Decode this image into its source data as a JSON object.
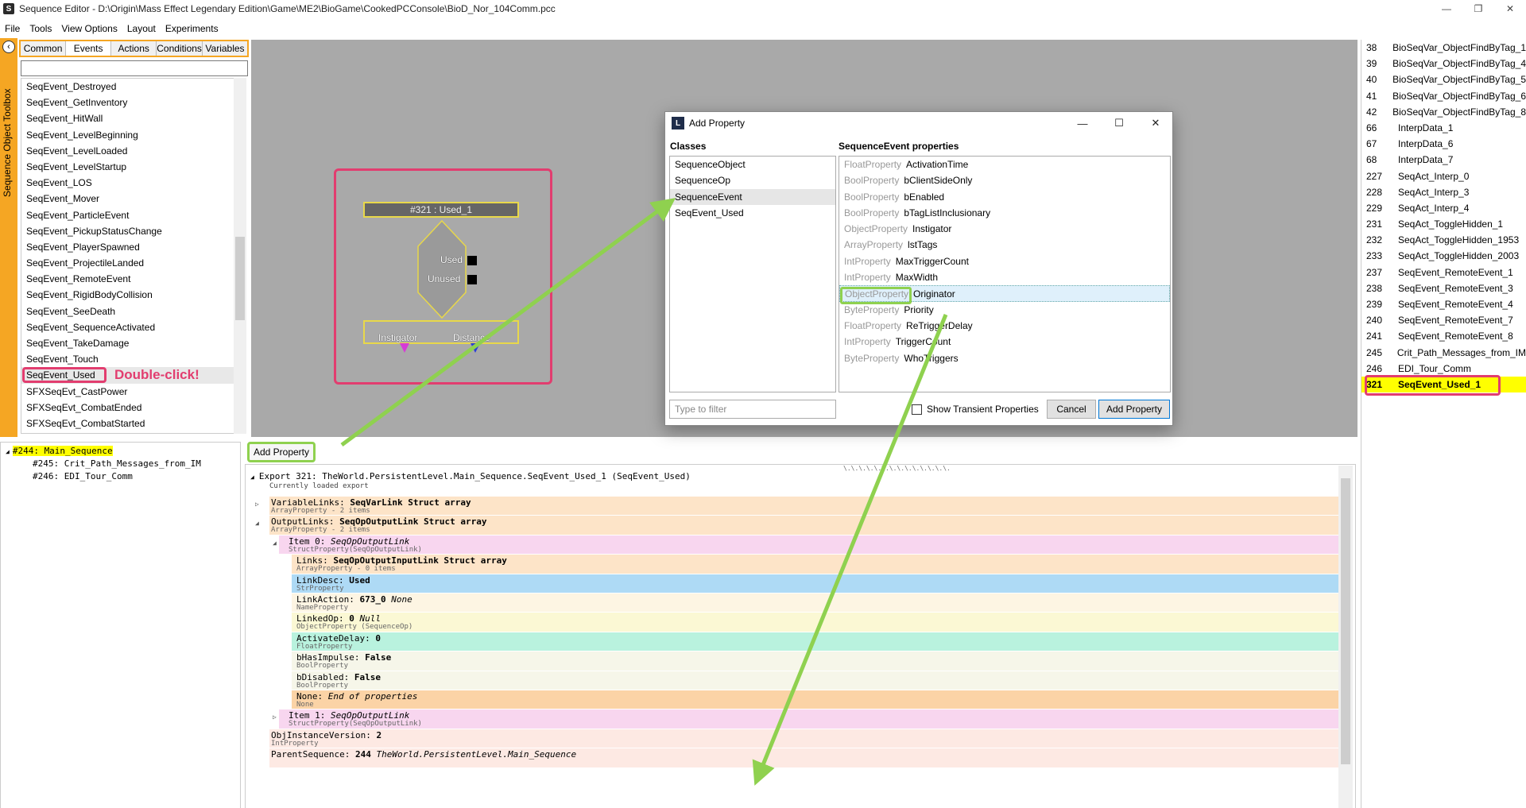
{
  "window": {
    "title": "Sequence Editor - D:\\Origin\\Mass Effect Legendary Edition\\Game\\ME2\\BioGame\\CookedPCConsole\\BioD_Nor_104Comm.pcc",
    "app_icon": "S",
    "minimize": "—",
    "maximize": "❐",
    "close": "✕"
  },
  "menu": [
    "File",
    "Tools",
    "View Options",
    "Layout",
    "Experiments"
  ],
  "toolbox": {
    "label": "Sequence Object Toolbox",
    "back_glyph": "‹",
    "tabs": [
      "Common",
      "Events",
      "Actions",
      "Conditions",
      "Variables"
    ],
    "active_tab": "Events",
    "events": [
      "SeqEvent_Destroyed",
      "SeqEvent_GetInventory",
      "SeqEvent_HitWall",
      "SeqEvent_LevelBeginning",
      "SeqEvent_LevelLoaded",
      "SeqEvent_LevelStartup",
      "SeqEvent_LOS",
      "SeqEvent_Mover",
      "SeqEvent_ParticleEvent",
      "SeqEvent_PickupStatusChange",
      "SeqEvent_PlayerSpawned",
      "SeqEvent_ProjectileLanded",
      "SeqEvent_RemoteEvent",
      "SeqEvent_RigidBodyCollision",
      "SeqEvent_SeeDeath",
      "SeqEvent_SequenceActivated",
      "SeqEvent_TakeDamage",
      "SeqEvent_Touch",
      "SeqEvent_Used",
      "SFXSeqEvt_CastPower",
      "SFXSeqEvt_CombatEnded",
      "SFXSeqEvt_CombatStarted"
    ],
    "selected_event_index": 18,
    "annotation": "Double-click!"
  },
  "node": {
    "title": "#321 : Used_1",
    "outputs": [
      "Used",
      "Unused"
    ],
    "vars": [
      "Instigator",
      "Distance"
    ]
  },
  "right_list": [
    {
      "id": "38",
      "name": "BioSeqVar_ObjectFindByTag_1"
    },
    {
      "id": "39",
      "name": "BioSeqVar_ObjectFindByTag_4"
    },
    {
      "id": "40",
      "name": "BioSeqVar_ObjectFindByTag_5"
    },
    {
      "id": "41",
      "name": "BioSeqVar_ObjectFindByTag_6"
    },
    {
      "id": "42",
      "name": "BioSeqVar_ObjectFindByTag_8"
    },
    {
      "id": "66",
      "name": "InterpData_1"
    },
    {
      "id": "67",
      "name": "InterpData_6"
    },
    {
      "id": "68",
      "name": "InterpData_7"
    },
    {
      "id": "227",
      "name": "SeqAct_Interp_0"
    },
    {
      "id": "228",
      "name": "SeqAct_Interp_3"
    },
    {
      "id": "229",
      "name": "SeqAct_Interp_4"
    },
    {
      "id": "231",
      "name": "SeqAct_ToggleHidden_1"
    },
    {
      "id": "232",
      "name": "SeqAct_ToggleHidden_1953"
    },
    {
      "id": "233",
      "name": "SeqAct_ToggleHidden_2003"
    },
    {
      "id": "237",
      "name": "SeqEvent_RemoteEvent_1"
    },
    {
      "id": "238",
      "name": "SeqEvent_RemoteEvent_3"
    },
    {
      "id": "239",
      "name": "SeqEvent_RemoteEvent_4"
    },
    {
      "id": "240",
      "name": "SeqEvent_RemoteEvent_7"
    },
    {
      "id": "241",
      "name": "SeqEvent_RemoteEvent_8"
    },
    {
      "id": "245",
      "name": "Crit_Path_Messages_from_IM"
    },
    {
      "id": "246",
      "name": "EDI_Tour_Comm"
    },
    {
      "id": "321",
      "name": "SeqEvent_Used_1"
    }
  ],
  "right_selected_index": 21,
  "tree": [
    {
      "label": "#244: Main_Sequence",
      "level": 0,
      "highlight": true
    },
    {
      "label": "#245: Crit_Path_Messages_from_IM",
      "level": 1,
      "highlight": false
    },
    {
      "label": "#246: EDI_Tour_Comm",
      "level": 1,
      "highlight": false
    }
  ],
  "tree_toggle": "◢",
  "add_property_button": "Add Property",
  "props_header": {
    "export": "Export 321: TheWorld.PersistentLevel.Main_Sequence.SeqEvent_Used_1 (SeqEvent_Used)",
    "sub": "Currently loaded export",
    "dots": "\\.\\.\\.\\.\\.\\.\\.\\.\\.\\.\\.\\.\\.\\."
  },
  "props": [
    {
      "indent": 0,
      "arrow": "▷",
      "name": "VariableLinks: ",
      "value": "SeqVarLink Struct array",
      "type": "ArrayProperty - 2 items",
      "bg": "#fde4c8",
      "italic": false
    },
    {
      "indent": 0,
      "arrow": "◢",
      "name": "OutputLinks: ",
      "value": "SeqOpOutputLink Struct array",
      "type": "ArrayProperty - 2 items",
      "bg": "#fde4c8",
      "italic": false
    },
    {
      "indent": 1,
      "arrow": "◢",
      "name": "Item 0: ",
      "value": "SeqOpOutputLink",
      "type": "StructProperty(SeqOpOutputLink)",
      "bg": "#f8d6ef",
      "italic": true
    },
    {
      "indent": 2,
      "arrow": "",
      "name": "Links: ",
      "value": "SeqOpOutputInputLink Struct array",
      "type": "ArrayProperty - 0 items",
      "bg": "#fde4c8",
      "italic": false
    },
    {
      "indent": 2,
      "arrow": "",
      "name": "LinkDesc: ",
      "value": "Used",
      "type": "StrProperty",
      "bg": "#aedaf5",
      "italic": false
    },
    {
      "indent": 2,
      "arrow": "",
      "name": "LinkAction: ",
      "value": "673_0 ",
      "extra": "None",
      "type": "NameProperty",
      "bg": "#fdf5e3",
      "italic": false
    },
    {
      "indent": 2,
      "arrow": "",
      "name": "LinkedOp: ",
      "value": "0 ",
      "extra": "Null",
      "type": "ObjectProperty (SequenceOp)",
      "bg": "#fbf8d4",
      "italic": false
    },
    {
      "indent": 2,
      "arrow": "",
      "name": "ActivateDelay: ",
      "value": "0",
      "type": "FloatProperty",
      "bg": "#b9f2de",
      "italic": false
    },
    {
      "indent": 2,
      "arrow": "",
      "name": "bHasImpulse: ",
      "value": "False",
      "type": "BoolProperty",
      "bg": "#f6f6e9",
      "italic": false
    },
    {
      "indent": 2,
      "arrow": "",
      "name": "bDisabled: ",
      "value": "False",
      "type": "BoolProperty",
      "bg": "#f6f6e9",
      "italic": false
    },
    {
      "indent": 2,
      "arrow": "",
      "name": "None: ",
      "value": "End of properties",
      "type": "None",
      "bg": "#fbd3a6",
      "italic": true
    },
    {
      "indent": 1,
      "arrow": "▷",
      "name": "Item 1: ",
      "value": "SeqOpOutputLink",
      "type": "StructProperty(SeqOpOutputLink)",
      "bg": "#f8d6ef",
      "italic": true
    },
    {
      "indent": 0,
      "arrow": "",
      "name": "ObjInstanceVersion: ",
      "value": "2",
      "type": "IntProperty",
      "bg": "#fde9e3",
      "italic": false
    },
    {
      "indent": 0,
      "arrow": "",
      "name": "ParentSequence: ",
      "value": "244 ",
      "extra": "TheWorld.PersistentLevel.Main_Sequence",
      "type": "",
      "bg": "#fde9e3",
      "italic": false
    }
  ],
  "dialog": {
    "title": "Add Property",
    "icon": "L",
    "min": "—",
    "max": "☐",
    "close": "✕",
    "classes_header": "Classes",
    "props_header": "SequenceEvent properties",
    "classes": [
      "SequenceObject",
      "SequenceOp",
      "SequenceEvent",
      "SeqEvent_Used"
    ],
    "selected_class_index": 2,
    "properties": [
      {
        "type": "FloatProperty",
        "name": "ActivationTime"
      },
      {
        "type": "BoolProperty",
        "name": "bClientSideOnly"
      },
      {
        "type": "BoolProperty",
        "name": "bEnabled"
      },
      {
        "type": "BoolProperty",
        "name": "bTagListInclusionary"
      },
      {
        "type": "ObjectProperty",
        "name": "Instigator"
      },
      {
        "type": "ArrayProperty",
        "name": "lstTags"
      },
      {
        "type": "IntProperty",
        "name": "MaxTriggerCount"
      },
      {
        "type": "IntProperty",
        "name": "MaxWidth"
      },
      {
        "type": "ObjectProperty",
        "name": "Originator"
      },
      {
        "type": "ByteProperty",
        "name": "Priority"
      },
      {
        "type": "FloatProperty",
        "name": "ReTriggerDelay"
      },
      {
        "type": "IntProperty",
        "name": "TriggerCount"
      },
      {
        "type": "ByteProperty",
        "name": "WhoTriggers"
      }
    ],
    "selected_property_index": 8,
    "filter_placeholder": "Type to filter",
    "transient_label": "Show Transient Properties",
    "cancel_label": "Cancel",
    "add_label": "Add Property"
  },
  "colors": {
    "accent_orange": "#f5a623",
    "annotation_pink": "#e23d6f",
    "annotation_green": "#8fd14f",
    "canvas_gray": "#a9a9a9",
    "highlight_yellow": "#ffff00"
  }
}
